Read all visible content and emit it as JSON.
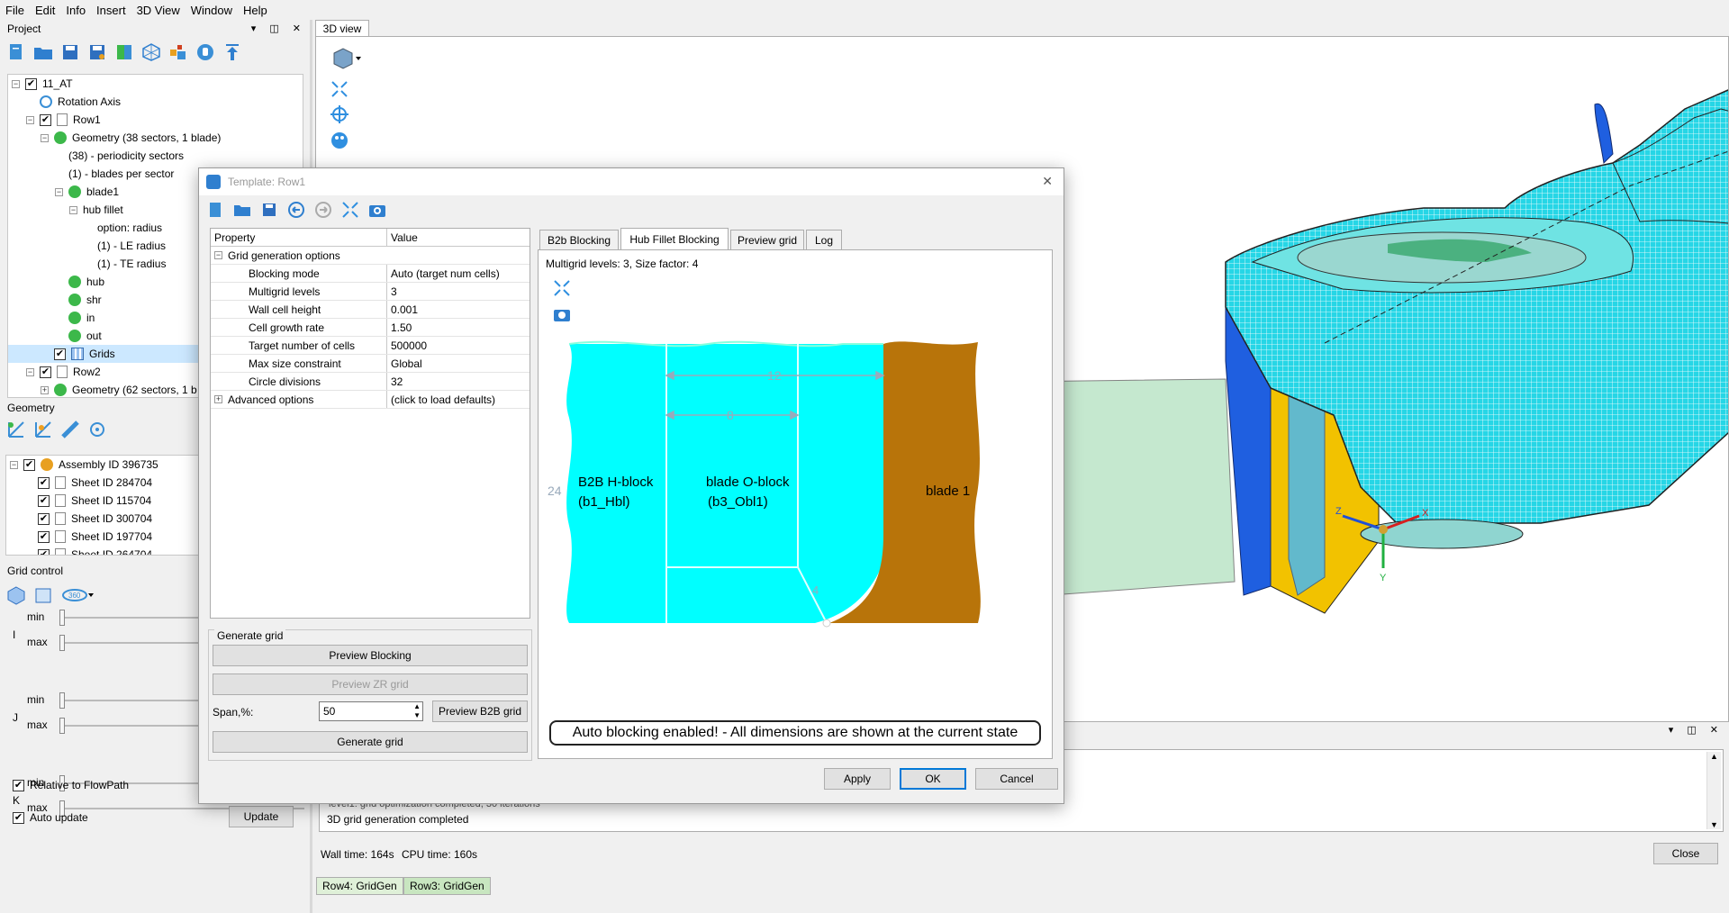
{
  "menu": [
    "File",
    "Edit",
    "Info",
    "Insert",
    "3D View",
    "Window",
    "Help"
  ],
  "project_panel": {
    "title": "Project",
    "tree": [
      {
        "label": "11_AT",
        "indent": 0,
        "cb": true,
        "exp": "-"
      },
      {
        "label": "Rotation Axis",
        "indent": 1,
        "icon": "blue"
      },
      {
        "label": "Row1",
        "indent": 1,
        "cb": true,
        "exp": "-",
        "icon": "sheet"
      },
      {
        "label": "Geometry (38 sectors, 1 blade)",
        "indent": 2,
        "exp": "-",
        "icon": "green"
      },
      {
        "label": "(38) - periodicity sectors",
        "indent": 3
      },
      {
        "label": "(1) - blades per sector",
        "indent": 3
      },
      {
        "label": "blade1",
        "indent": 3,
        "exp": "-",
        "icon": "green"
      },
      {
        "label": "hub fillet",
        "indent": 4,
        "exp": "-"
      },
      {
        "label": "option: radius",
        "indent": 5
      },
      {
        "label": "(1) - LE radius",
        "indent": 5
      },
      {
        "label": "(1) - TE radius",
        "indent": 5
      },
      {
        "label": "hub",
        "indent": 3,
        "icon": "green"
      },
      {
        "label": "shr",
        "indent": 3,
        "icon": "green"
      },
      {
        "label": "in",
        "indent": 3,
        "icon": "green"
      },
      {
        "label": "out",
        "indent": 3,
        "icon": "green"
      },
      {
        "label": "Grids",
        "indent": 2,
        "cb": true,
        "icon": "grid",
        "selected": true
      },
      {
        "label": "Row2",
        "indent": 1,
        "cb": true,
        "exp": "-",
        "icon": "sheet"
      },
      {
        "label": "Geometry (62 sectors, 1 b",
        "indent": 2,
        "exp": "+",
        "icon": "green"
      }
    ]
  },
  "geometry_panel": {
    "title": "Geometry",
    "tree": [
      {
        "label": "Assembly ID 396735",
        "indent": 0,
        "cb": true,
        "exp": "-",
        "icon": "assembly"
      },
      {
        "label": "Sheet ID 284704",
        "indent": 1,
        "cb": true,
        "icon": "sheet"
      },
      {
        "label": "Sheet ID 115704",
        "indent": 1,
        "cb": true,
        "icon": "sheet"
      },
      {
        "label": "Sheet ID 300704",
        "indent": 1,
        "cb": true,
        "icon": "sheet"
      },
      {
        "label": "Sheet ID 197704",
        "indent": 1,
        "cb": true,
        "icon": "sheet"
      },
      {
        "label": "Sheet ID 264704",
        "indent": 1,
        "cb": true,
        "icon": "sheet"
      }
    ]
  },
  "grid_control": {
    "title": "Grid control",
    "axes": [
      "I",
      "J",
      "K"
    ],
    "min_label": "min",
    "max_label": "max",
    "relative_label": "Relative to FlowPath",
    "auto_update_label": "Auto update",
    "update_button": "Update"
  },
  "view3d": {
    "tab": "3D view",
    "triad": {
      "x": "X",
      "y": "Y",
      "z": "Z"
    }
  },
  "dialog": {
    "title": "Template: Row1",
    "columns": [
      "Property",
      "Value"
    ],
    "group": "Grid generation options",
    "properties": [
      {
        "name": "Blocking mode",
        "value": "Auto (target num cells)"
      },
      {
        "name": "Multigrid levels",
        "value": "3"
      },
      {
        "name": "Wall cell height",
        "value": "0.001"
      },
      {
        "name": "Cell growth rate",
        "value": "1.50"
      },
      {
        "name": "Target number of cells",
        "value": "500000"
      },
      {
        "name": "Max size constraint",
        "value": "Global"
      },
      {
        "name": "Circle divisions",
        "value": "32"
      }
    ],
    "advanced": {
      "name": "Advanced options",
      "value": "(click to load defaults)"
    },
    "generate_group": "Generate grid",
    "preview_blocking": "Preview Blocking",
    "preview_zr": "Preview ZR grid",
    "span_label": "Span,%:",
    "span_value": "50",
    "preview_b2b": "Preview B2B grid",
    "generate": "Generate grid",
    "tabs": [
      "B2b Blocking",
      "Hub Fillet Blocking",
      "Preview grid",
      "Log"
    ],
    "active_tab": 1,
    "multigrid_info": "Multigrid levels: 3, Size factor: 4",
    "blocks": {
      "b2b_name": "B2B H-block",
      "b2b_id": "(b1_Hbl)",
      "oblock_name": "blade O-block",
      "oblock_id": "(b3_Obl1)",
      "blade": "blade 1",
      "dim_top": "12",
      "dim_mid": "8",
      "dim_left": "24",
      "dim_corner": "4"
    },
    "banner": "Auto blocking enabled! - All dimensions are shown at the current state",
    "apply": "Apply",
    "ok": "OK",
    "cancel": "Cancel"
  },
  "log": {
    "lines": [
      "level1: grid optimization completed, 30 iterations",
      "3D grid generation completed"
    ],
    "wall_time": "Wall time: 164s",
    "cpu_time": "CPU time: 160s",
    "close": "Close"
  },
  "bottom_tabs": [
    "Row4: GridGen",
    "Row3: GridGen"
  ],
  "colors": {
    "cyan_block": "#00ffff",
    "blade_brown": "#b8740a",
    "selection": "#cce8ff",
    "bottom_tab": "#dff0d8"
  }
}
